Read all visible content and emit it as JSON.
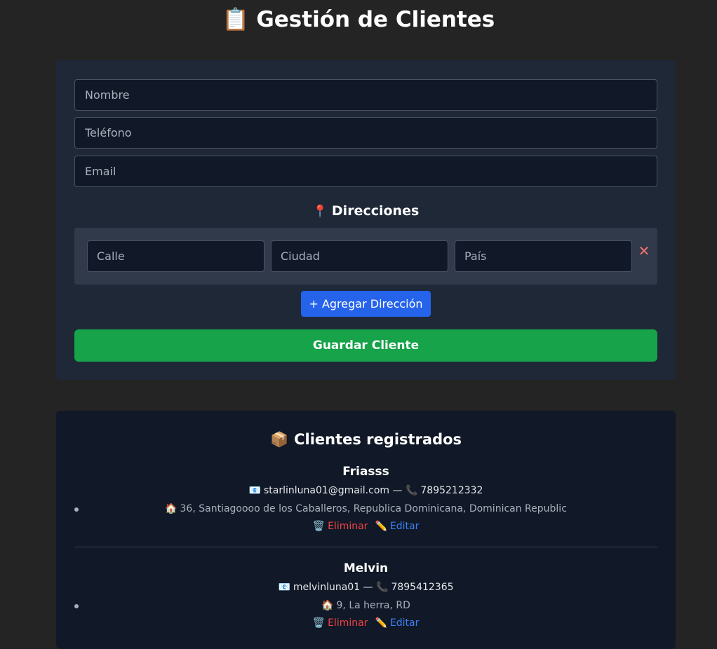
{
  "header": {
    "title": "Gestión de Clientes",
    "title_icon": "📋"
  },
  "form": {
    "nombre_placeholder": "Nombre",
    "telefono_placeholder": "Teléfono",
    "email_placeholder": "Email",
    "addresses_title": "Direcciones",
    "addresses_icon": "📍",
    "address_fields": {
      "calle_placeholder": "Calle",
      "ciudad_placeholder": "Ciudad",
      "pais_placeholder": "País"
    },
    "remove_symbol": "✕",
    "add_address_label": "+ Agregar Dirección",
    "save_label": "Guardar Cliente"
  },
  "list": {
    "title": "Clientes registrados",
    "title_icon": "📦",
    "delete_label": "Eliminar",
    "edit_label": "Editar",
    "separator": " — ",
    "clients": [
      {
        "name": "Friasss",
        "email": "starlinluna01@gmail.com",
        "phone": "7895212332",
        "address": "36, Santiagoooo de los Caballeros, Republica Dominicana, Dominican Republic"
      },
      {
        "name": "Melvin",
        "email": "melvinluna01",
        "phone": "7895412365",
        "address": "9, La herra, RD"
      }
    ]
  },
  "icons": {
    "mail": "📧",
    "phone": "📞",
    "home": "🏠",
    "trash": "🗑️",
    "pencil": "✏️"
  },
  "colors": {
    "background": "#242424",
    "panel": "#1e2837",
    "list_panel": "#111827",
    "add_button": "#2563eb",
    "save_button": "#16a34a",
    "delete": "#ef4444",
    "edit": "#3b82f6"
  }
}
